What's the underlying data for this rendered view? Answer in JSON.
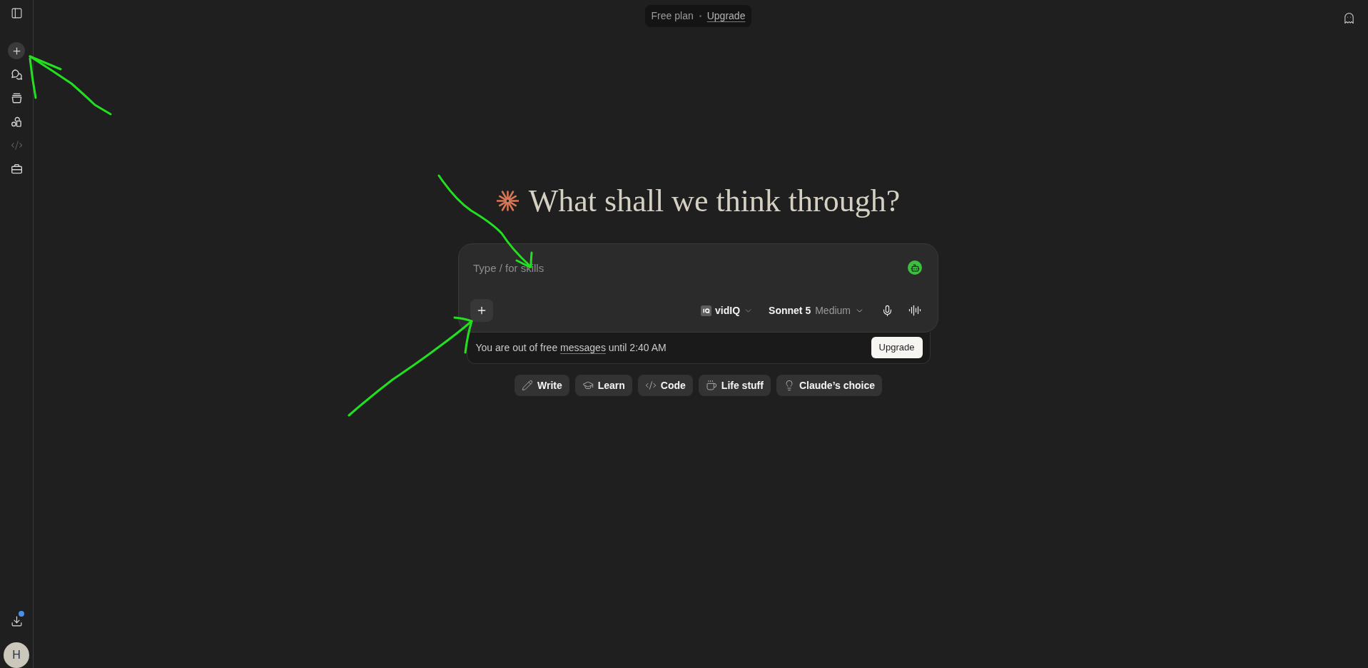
{
  "sidebar": {
    "items": [
      {
        "kind": "toggle",
        "disabled": false
      },
      {
        "kind": "new_chat",
        "disabled": false
      },
      {
        "kind": "chats",
        "disabled": false
      },
      {
        "kind": "projects",
        "disabled": false
      },
      {
        "kind": "artifacts",
        "disabled": false
      },
      {
        "kind": "code",
        "disabled": true
      },
      {
        "kind": "toolbox",
        "disabled": false
      }
    ],
    "footer": [
      {
        "kind": "download",
        "notification": true
      }
    ],
    "avatar": {
      "initial": "H"
    }
  },
  "plan_banner": {
    "plan": "Free plan",
    "link": "Upgrade"
  },
  "heading": "What shall we think through?",
  "composer": {
    "placeholder": "Type / for skills",
    "connector": "vidIQ",
    "model": "Sonnet 5",
    "effort": "Medium"
  },
  "limit_notice": {
    "before": "You are out of free",
    "link": "messages",
    "after": "until 2:40 AM",
    "button": "Upgrade"
  },
  "chips": [
    {
      "kind": "write",
      "label": "Write"
    },
    {
      "kind": "learn",
      "label": "Learn"
    },
    {
      "kind": "code",
      "label": "Code"
    },
    {
      "kind": "life",
      "label": "Life stuff"
    },
    {
      "kind": "choice",
      "label": "Claude’s choice"
    }
  ],
  "annotations": [
    {
      "kind": "arrow"
    },
    {
      "kind": "arrow"
    },
    {
      "kind": "arrow"
    }
  ]
}
